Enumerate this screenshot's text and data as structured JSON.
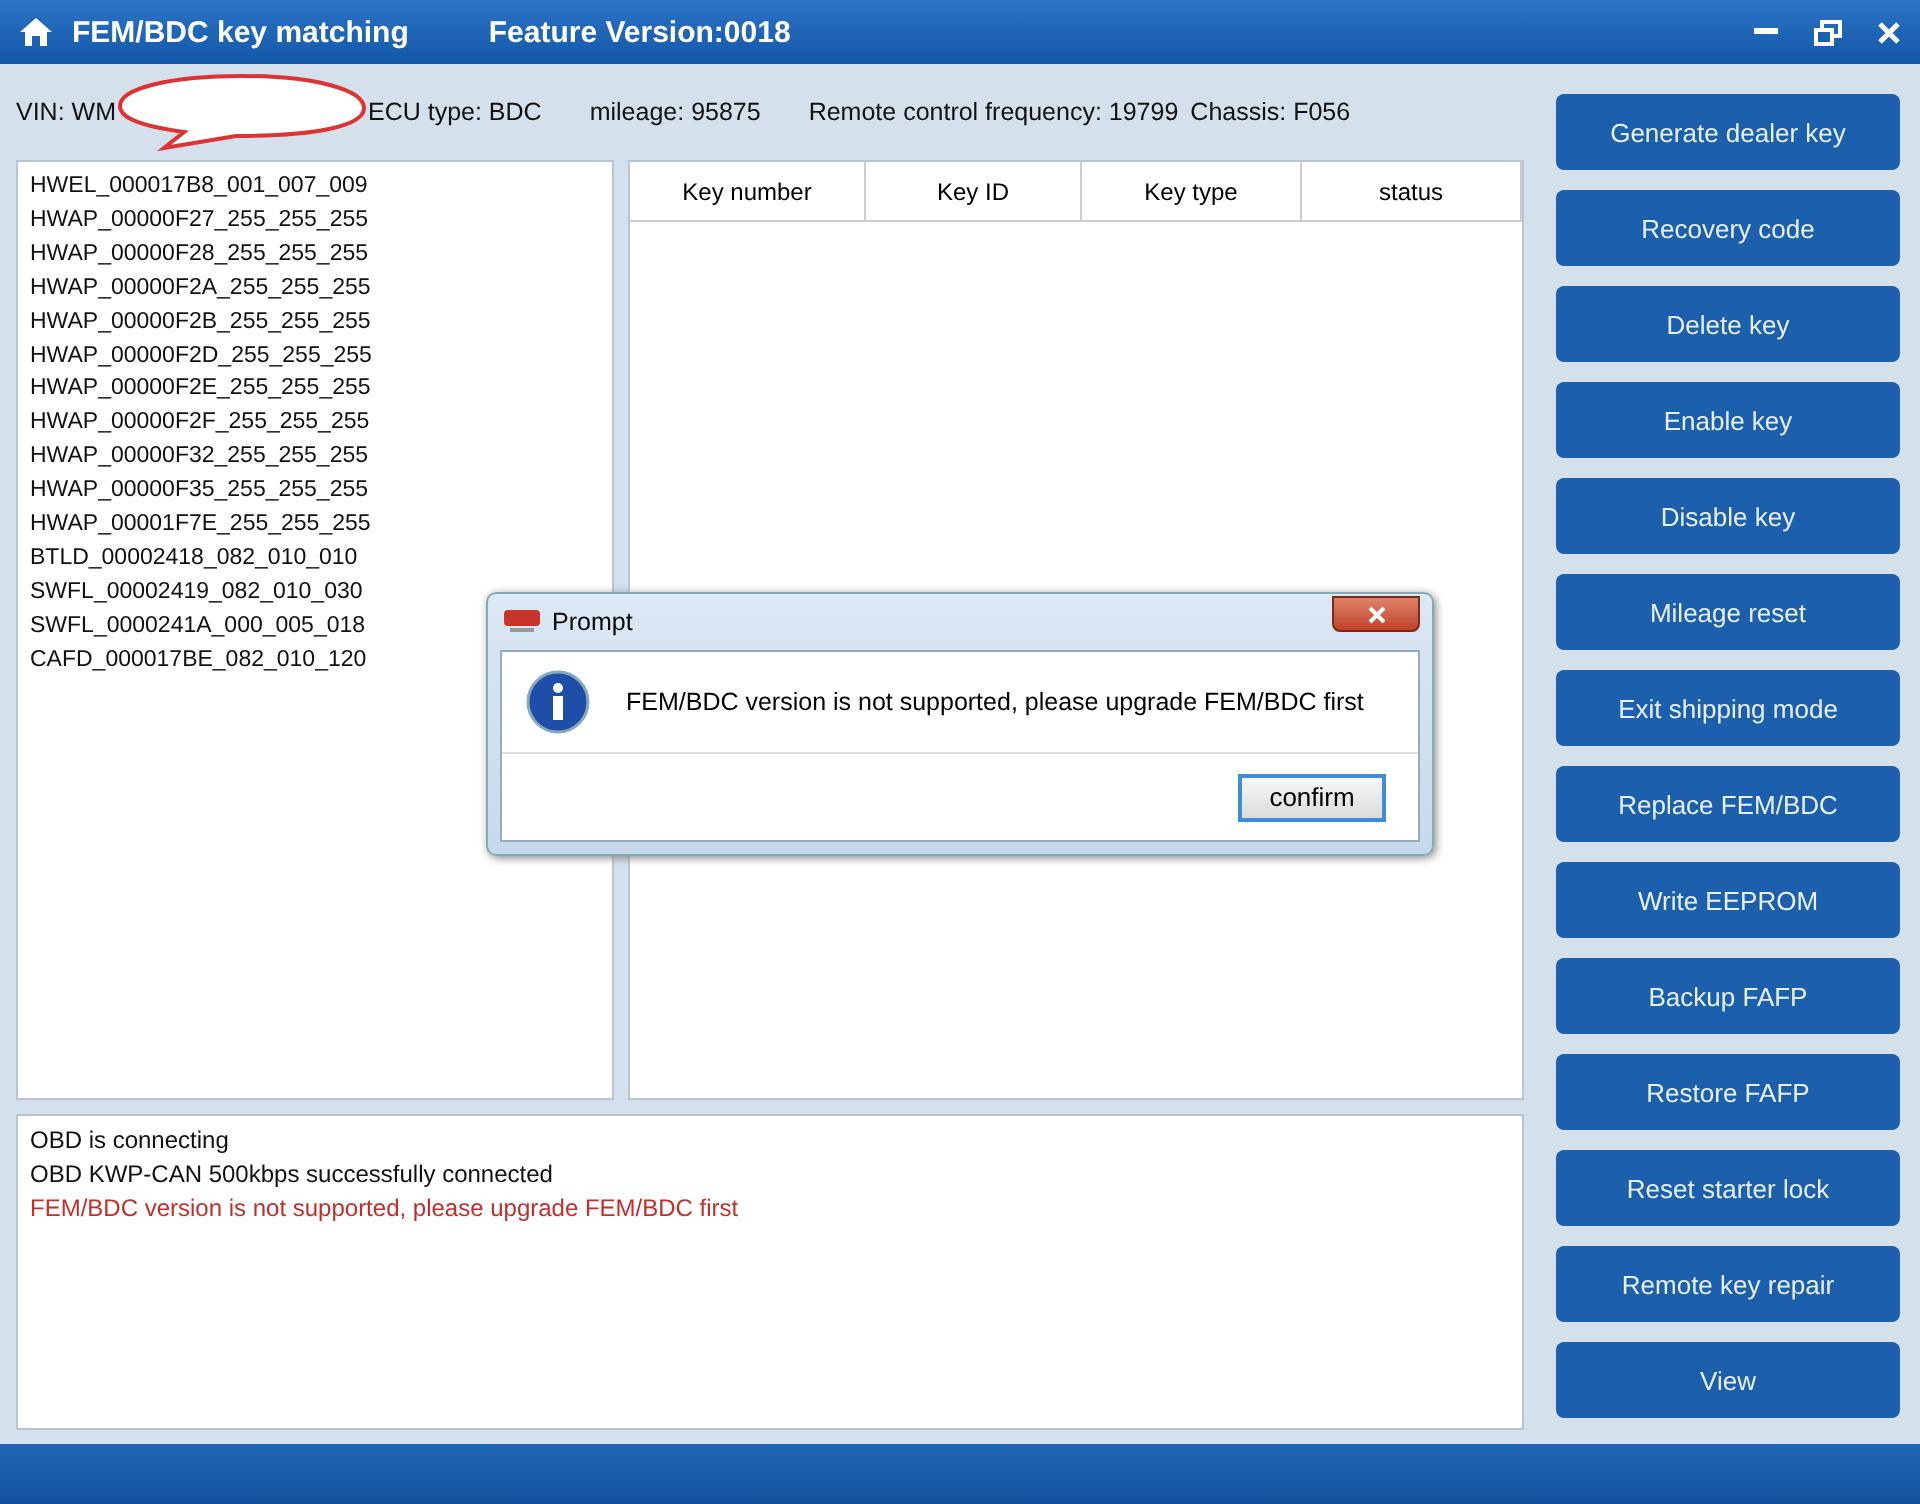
{
  "window": {
    "title": "FEM/BDC key matching",
    "feature_version": "Feature Version:0018"
  },
  "info": [
    "VIN: WM",
    "ECU type: BDC",
    "mileage: 95875",
    "Remote control frequency: 19799",
    "Chassis: F056"
  ],
  "modules": [
    "HWEL_000017B8_001_007_009",
    "HWAP_00000F27_255_255_255",
    "HWAP_00000F28_255_255_255",
    "HWAP_00000F2A_255_255_255",
    "HWAP_00000F2B_255_255_255",
    "HWAP_00000F2D_255_255_255",
    "HWAP_00000F2E_255_255_255",
    "HWAP_00000F2F_255_255_255",
    "HWAP_00000F32_255_255_255",
    "HWAP_00000F35_255_255_255",
    "HWAP_00001F7E_255_255_255",
    "BTLD_00002418_082_010_010",
    "SWFL_00002419_082_010_030",
    "SWFL_0000241A_000_005_018",
    "CAFD_000017BE_082_010_120"
  ],
  "table": {
    "columns": [
      "Key number",
      "Key ID",
      "Key type",
      "status"
    ]
  },
  "log": [
    {
      "text": "OBD is connecting",
      "kind": "info"
    },
    {
      "text": "OBD KWP-CAN 500kbps successfully connected",
      "kind": "info"
    },
    {
      "text": "FEM/BDC version is not supported, please upgrade FEM/BDC first",
      "kind": "error"
    }
  ],
  "buttons": [
    "Generate dealer key",
    "Recovery code",
    "Delete key",
    "Enable key",
    "Disable key",
    "Mileage reset",
    "Exit shipping mode",
    "Replace FEM/BDC",
    "Write EEPROM",
    "Backup FAFP",
    "Restore FAFP",
    "Reset starter lock",
    "Remote key repair",
    "View"
  ],
  "dialog": {
    "title": "Prompt",
    "message": "FEM/BDC version is not supported, please upgrade FEM/BDC first",
    "button": "confirm"
  }
}
